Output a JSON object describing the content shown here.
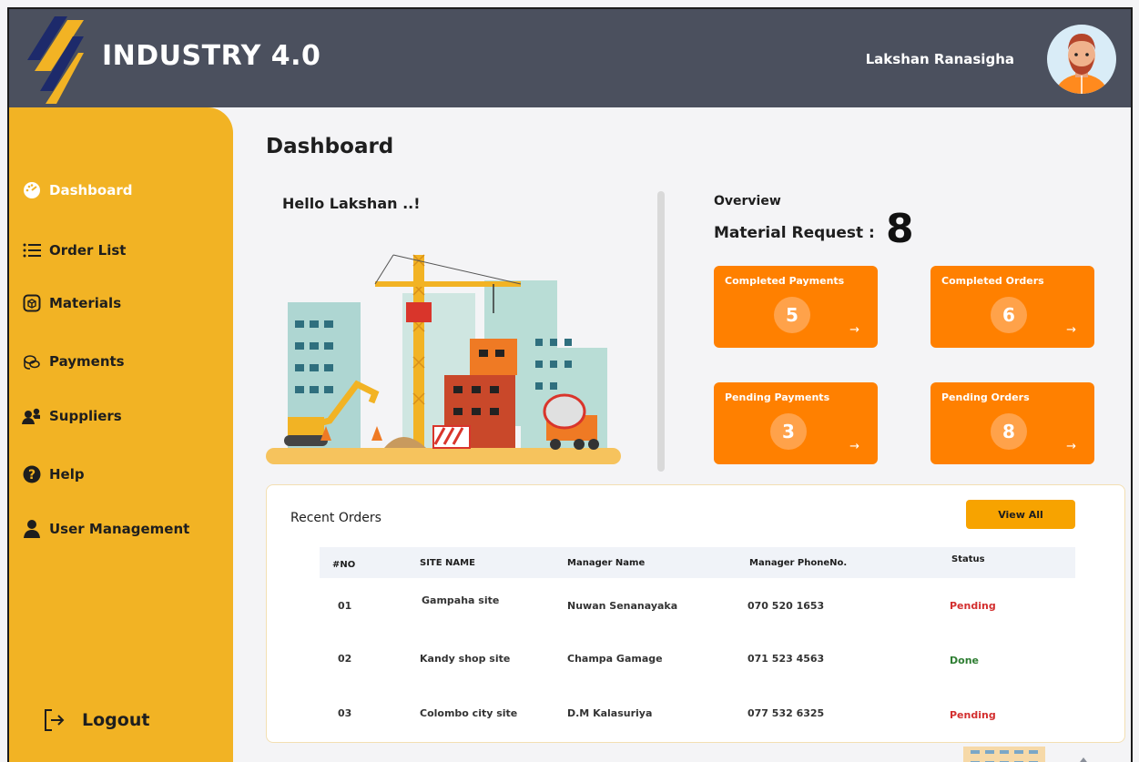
{
  "header": {
    "app_title": "INDUSTRY 4.0",
    "user_name": "Lakshan Ranasigha"
  },
  "sidebar": {
    "items": [
      {
        "label": "Dashboard",
        "icon": "gauge-icon",
        "active": true
      },
      {
        "label": "Order List",
        "icon": "list-icon",
        "active": false
      },
      {
        "label": "Materials",
        "icon": "box-icon",
        "active": false
      },
      {
        "label": "Payments",
        "icon": "coins-icon",
        "active": false
      },
      {
        "label": "Suppliers",
        "icon": "people-icon",
        "active": false
      },
      {
        "label": "Help",
        "icon": "help-icon",
        "active": false
      },
      {
        "label": "User Management",
        "icon": "user-icon",
        "active": false
      }
    ],
    "logout_label": "Logout"
  },
  "main": {
    "page_title": "Dashboard",
    "greeting": "Hello Lakshan ..!",
    "overview": {
      "label": "Overview",
      "material_request_label": "Material Request :",
      "material_request_value": "8",
      "cards": [
        {
          "label": "Completed Payments",
          "value": "5"
        },
        {
          "label": "Completed Orders",
          "value": "6"
        },
        {
          "label": "Pending Payments",
          "value": "3"
        },
        {
          "label": "Pending Orders",
          "value": "8"
        }
      ]
    },
    "recent_orders": {
      "title": "Recent Orders",
      "view_all_label": "View All",
      "columns": [
        "#NO",
        "SITE NAME",
        "Manager Name",
        "Manager PhoneNo.",
        "Status"
      ],
      "rows": [
        {
          "no": "01",
          "site": "Gampaha site",
          "manager": "Nuwan Senanayaka",
          "phone": "070 520 1653",
          "status": "Pending"
        },
        {
          "no": "02",
          "site": "Kandy shop site",
          "manager": "Champa Gamage",
          "phone": "071 523 4563",
          "status": "Done"
        },
        {
          "no": "03",
          "site": "Colombo city site",
          "manager": "D.M Kalasuriya",
          "phone": "077 532 6325",
          "status": "Pending"
        }
      ]
    }
  },
  "colors": {
    "header_bg": "#4b505e",
    "sidebar_bg": "#f2b324",
    "card_bg": "#ff8000",
    "accent": "#f7a300",
    "pending": "#d32f2f",
    "done": "#2e7d32"
  }
}
